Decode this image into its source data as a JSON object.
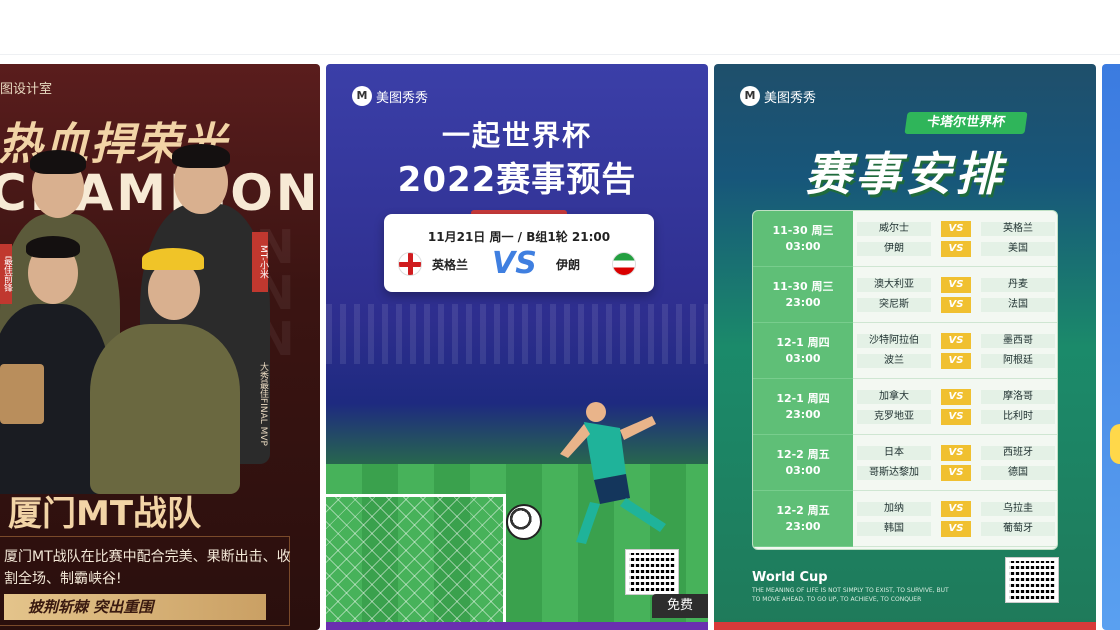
{
  "card1": {
    "brand": "图设计室",
    "headline": "热血捍荣光",
    "headline_en": "CHAMPION",
    "ghost_letters": "N N N",
    "tag_left": "最佳前锋",
    "tag_mid": "MT-小米",
    "tag_right": "大秀最佳FINAL MVP",
    "team_title": "厦门MT战队",
    "description": "厦门MT战队在比赛中配合完美、果断出击、收割全场、制霸峡谷!",
    "slogan": "披荆斩棘  突出重围"
  },
  "card2": {
    "logo": "美图秀秀",
    "title_line1": "一起世界杯",
    "title_line2": "2022赛事预告",
    "match_info": "11月21日 周一 /  B组1轮 21:00",
    "team_left": "英格兰",
    "vs": "VS",
    "team_right": "伊朗",
    "badge": "免费"
  },
  "card3": {
    "logo": "美图秀秀",
    "badge": "卡塔尔世界杯",
    "title": "赛事安排",
    "vs_label": "VS",
    "rows": [
      {
        "date": "11-30 周三",
        "time": "03:00",
        "games": [
          [
            "威尔士",
            "英格兰"
          ],
          [
            "伊朗",
            "美国"
          ]
        ]
      },
      {
        "date": "11-30 周三",
        "time": "23:00",
        "games": [
          [
            "澳大利亚",
            "丹麦"
          ],
          [
            "突尼斯",
            "法国"
          ]
        ]
      },
      {
        "date": "12-1 周四",
        "time": "03:00",
        "games": [
          [
            "沙特阿拉伯",
            "墨西哥"
          ],
          [
            "波兰",
            "阿根廷"
          ]
        ]
      },
      {
        "date": "12-1 周四",
        "time": "23:00",
        "games": [
          [
            "加拿大",
            "摩洛哥"
          ],
          [
            "克罗地亚",
            "比利时"
          ]
        ]
      },
      {
        "date": "12-2 周五",
        "time": "03:00",
        "games": [
          [
            "日本",
            "西班牙"
          ],
          [
            "哥斯达黎加",
            "德国"
          ]
        ]
      },
      {
        "date": "12-2 周五",
        "time": "23:00",
        "games": [
          [
            "加纳",
            "乌拉圭"
          ],
          [
            "韩国",
            "葡萄牙"
          ]
        ]
      }
    ],
    "footer_title": "World Cup",
    "footer_sub": "THE MEANING OF LIFE IS NOT SIMPLY TO EXIST, TO SURVIVE, BUT TO MOVE AHEAD, TO GO UP, TO ACHIEVE, TO CONQUER"
  },
  "colors": {
    "card1_bg": "#3b1412",
    "card2_bg": "#2e2e8e",
    "card3_bg": "#1b8a6a",
    "accent_gold": "#f2d4a6",
    "vs_yellow": "#f0c030"
  }
}
